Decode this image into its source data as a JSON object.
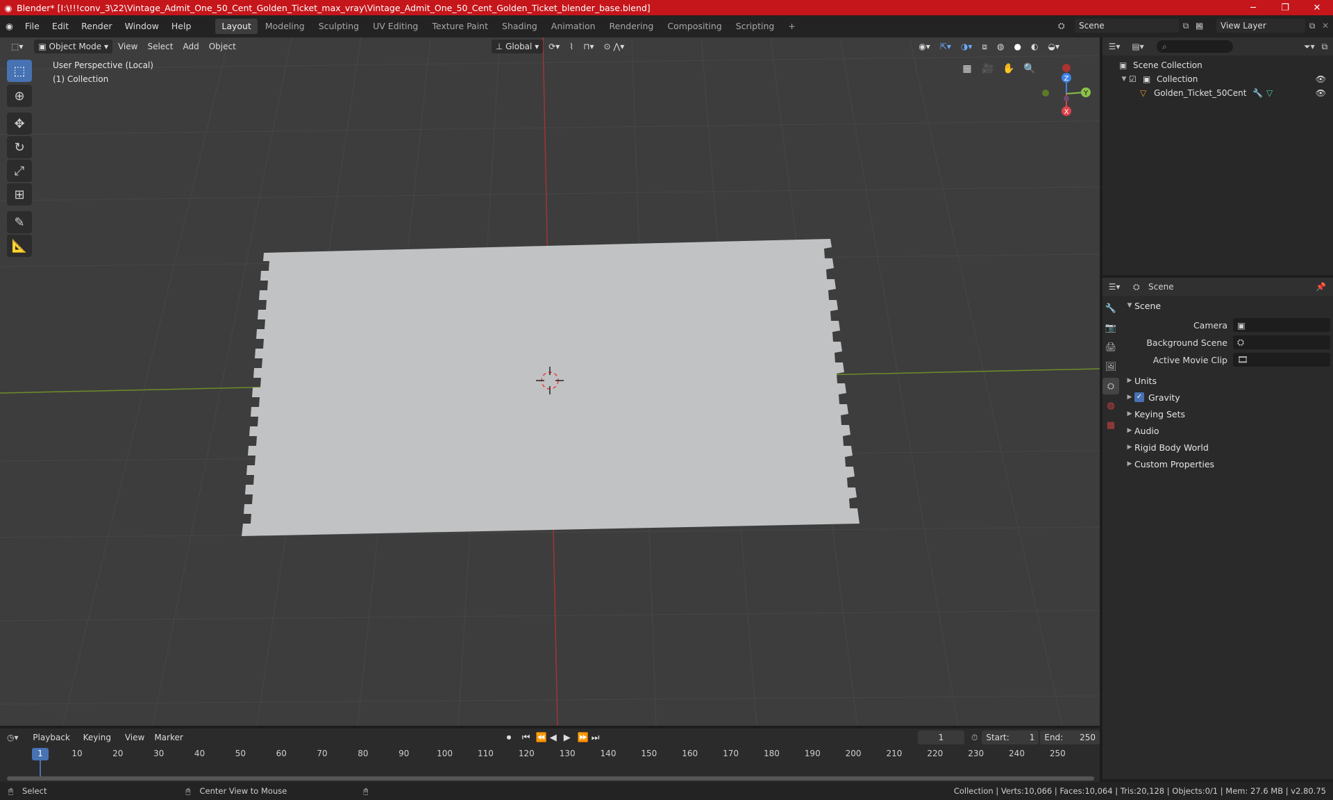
{
  "window": {
    "title": "Blender* [I:\\!!!conv_3\\22\\Vintage_Admit_One_50_Cent_Golden_Ticket_max_vray\\Vintage_Admit_One_50_Cent_Golden_Ticket_blender_base.blend]",
    "minimize": "─",
    "maximize": "❐",
    "close": "✕"
  },
  "menu": {
    "items": [
      "File",
      "Edit",
      "Render",
      "Window",
      "Help"
    ],
    "workspaces": [
      "Layout",
      "Modeling",
      "Sculpting",
      "UV Editing",
      "Texture Paint",
      "Shading",
      "Animation",
      "Rendering",
      "Compositing",
      "Scripting"
    ],
    "active_workspace": "Layout",
    "add_workspace": "+",
    "scene_name": "Scene",
    "view_layer": "View Layer"
  },
  "viewport": {
    "mode": "Object Mode",
    "menus": [
      "View",
      "Select",
      "Add",
      "Object"
    ],
    "orientation": "Global",
    "perspective_label": "User Perspective (Local)",
    "collection_label": "(1) Collection",
    "axes": {
      "x": "X",
      "y": "Y",
      "z": "Z"
    }
  },
  "outliner": {
    "scene_collection": "Scene Collection",
    "collection": "Collection",
    "object": "Golden_Ticket_50Cent"
  },
  "properties": {
    "header": "Scene",
    "panel": "Scene",
    "camera_label": "Camera",
    "background_scene_label": "Background Scene",
    "active_clip_label": "Active Movie Clip",
    "subpanels": [
      "Units",
      "Gravity",
      "Keying Sets",
      "Audio",
      "Rigid Body World",
      "Custom Properties"
    ],
    "gravity_checked": true
  },
  "timeline": {
    "menus": [
      "Playback",
      "Keying",
      "View",
      "Marker"
    ],
    "current_frame": "1",
    "start_label": "Start:",
    "start": "1",
    "end_label": "End:",
    "end": "250",
    "ruler": [
      "1",
      "10",
      "20",
      "30",
      "40",
      "50",
      "60",
      "70",
      "80",
      "90",
      "100",
      "110",
      "120",
      "130",
      "140",
      "150",
      "160",
      "170",
      "180",
      "190",
      "200",
      "210",
      "220",
      "230",
      "240",
      "250"
    ]
  },
  "status": {
    "select": "Select",
    "center_view": "Center View to Mouse",
    "stats": "Collection | Verts:10,066 | Faces:10,064 | Tris:20,128 | Objects:0/1 | Mem: 27.6 MB | v2.80.75"
  },
  "colors": {
    "title_bar": "#c5161b",
    "accent": "#4772b3",
    "x_axis": "#e0424b",
    "y_axis": "#8bc34a",
    "z_axis": "#3d84e6"
  }
}
